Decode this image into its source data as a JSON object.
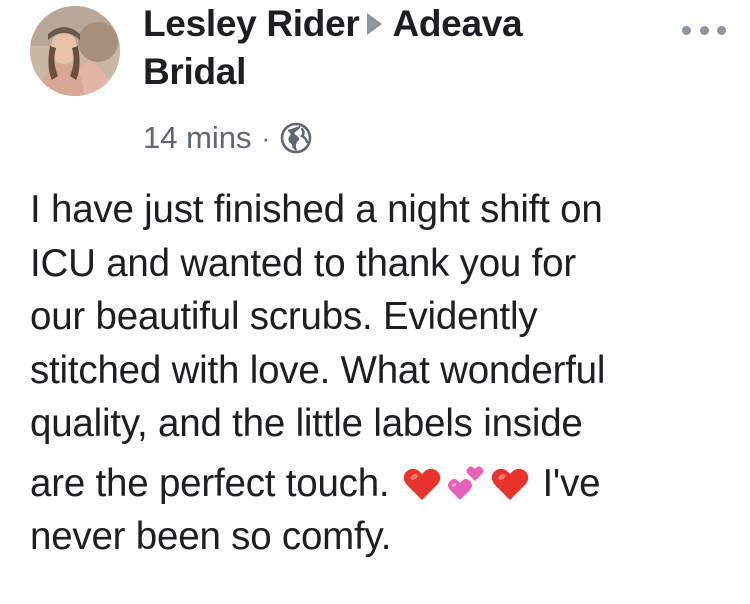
{
  "post": {
    "author": "Lesley Rider",
    "target_line1": "Adeava",
    "target_line2": "Bridal",
    "timestamp": "14 mins",
    "separator": "·",
    "privacy_icon": "globe-icon",
    "more_icon": "more-options-icon",
    "body_lines": [
      "I have just finished a night shift on",
      "ICU and wanted to thank you for",
      "our beautiful scrubs. Evidently",
      "stitched with love. What wonderful",
      "quality, and the little labels inside"
    ],
    "line6_text": "are the perfect touch.",
    "line6_tail": "I've",
    "line7": "never been so comfy.",
    "emojis": [
      "red-heart-icon",
      "two-hearts-icon",
      "red-heart-icon"
    ]
  },
  "colors": {
    "text": "#1c1e21",
    "meta": "#606770",
    "icon_grey": "#90949c",
    "heart_red": "#e8332a",
    "heart_pink": "#e861b8"
  }
}
